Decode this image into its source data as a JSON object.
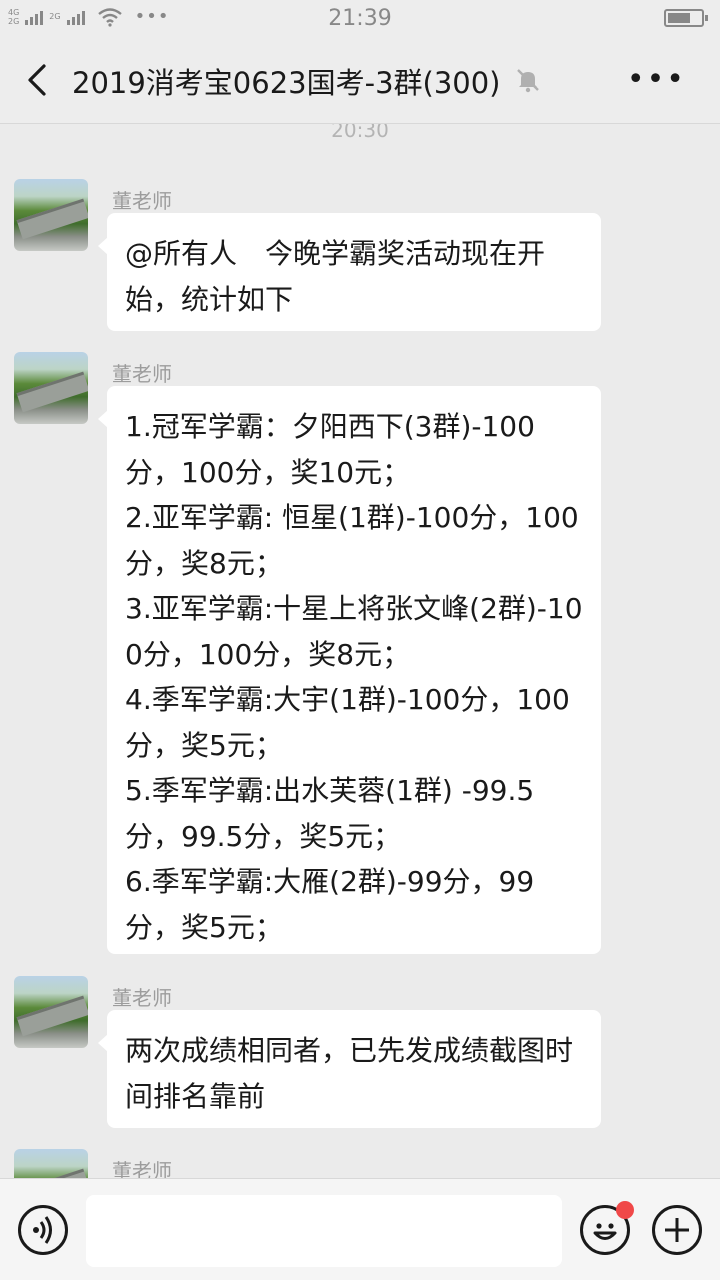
{
  "status_bar": {
    "network_top": "4G",
    "network_bottom": "2G",
    "network2": "2G",
    "time": "21:39",
    "dots": "•••"
  },
  "nav": {
    "title": "2019消考宝0623国考-3群(300)",
    "more_icon": "more-dots-icon"
  },
  "chat": {
    "timestamp": "20:30",
    "messages": [
      {
        "sender": "董老师",
        "text": "@所有人　今晚学霸奖活动现在开始，统计如下"
      },
      {
        "sender": "董老师",
        "text": "1.冠军学霸：夕阳西下(3群)-100分，100分，奖10元；\n2.亚军学霸: 恒星(1群)-100分，100分，奖8元；\n3.亚军学霸:十星上将张文峰(2群)-100分，100分，奖8元；\n4.季军学霸:大宇(1群)-100分，100分，奖5元；\n5.季军学霸:出水芙蓉(1群) -99.5分，99.5分，奖5元；\n6.季军学霸:大雁(2群)-99分，99分，奖5元；"
      },
      {
        "sender": "董老师",
        "text": "两次成绩相同者，已先发成绩截图时间排名靠前"
      },
      {
        "sender": "董老师",
        "text": ""
      }
    ]
  },
  "input_bar": {
    "message_value": "",
    "badge_color": "#f04848"
  },
  "colors": {
    "background": "#ebebeb",
    "bubble": "#ffffff",
    "bar": "#ededed"
  }
}
